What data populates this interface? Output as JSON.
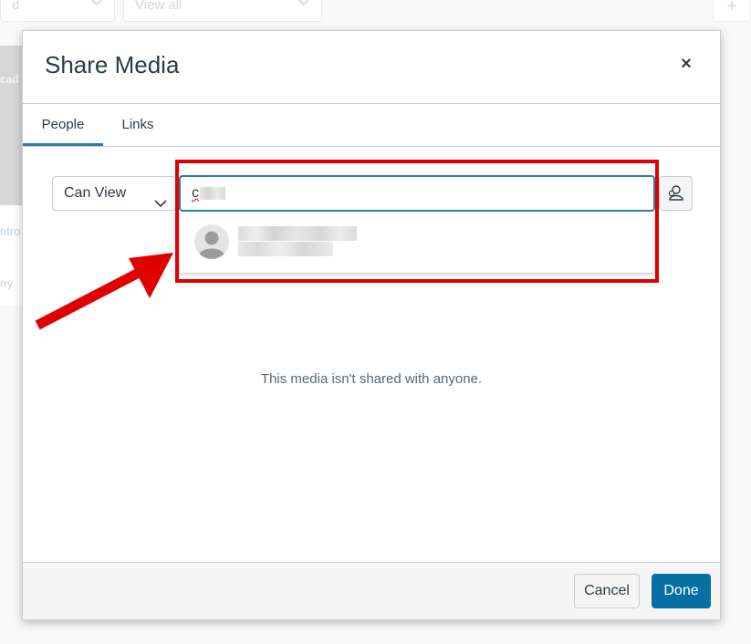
{
  "background": {
    "filter_1_text": "d",
    "filter_2_text": "View all",
    "card_title_fragment": "ntro",
    "card_sub_fragment": "rry",
    "thumb_text": "cad"
  },
  "dialog": {
    "title": "Share Media",
    "close_symbol": "×",
    "tabs": [
      {
        "label": "People",
        "active": true
      },
      {
        "label": "Links",
        "active": false
      }
    ],
    "permission": {
      "selected": "Can View"
    },
    "search": {
      "typed_visible": "c"
    },
    "empty_message": "This media isn't shared with anyone.",
    "footer": {
      "cancel_label": "Cancel",
      "done_label": "Done"
    }
  },
  "colors": {
    "accent": "#2d7ba9",
    "primary_button": "#0770a3",
    "annotation": "#e00000"
  },
  "icons": {
    "close": "close-icon",
    "chevron": "chevron-down-icon",
    "user_search": "users-icon",
    "avatar": "avatar-icon"
  }
}
